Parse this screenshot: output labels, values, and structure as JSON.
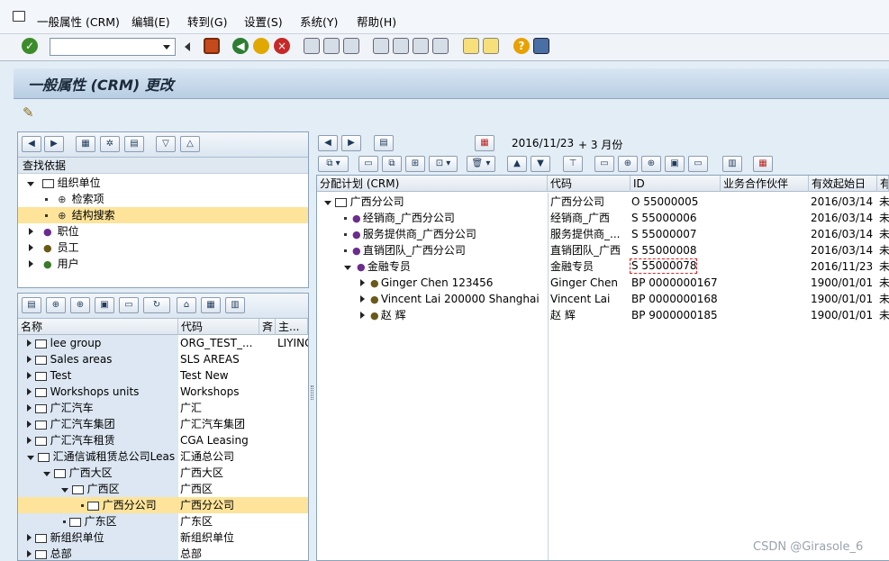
{
  "menu": [
    "一般属性 (CRM)",
    "编辑(E)",
    "转到(G)",
    "设置(S)",
    "系统(Y)",
    "帮助(H)"
  ],
  "title": "一般属性 (CRM) 更改",
  "search": {
    "header": "查找依据",
    "tree": [
      {
        "label": "组织单位"
      },
      {
        "label": "检索项"
      },
      {
        "label": "结构搜索"
      },
      {
        "label": "职位"
      },
      {
        "label": "员工"
      },
      {
        "label": "用户"
      }
    ]
  },
  "hitlist": {
    "col_name": "名称",
    "col_code": "代码",
    "col_x": "斉",
    "col_main": "主...",
    "rows": [
      {
        "name": "lee group",
        "code": "ORG_TEST_...",
        "main": "LIYING"
      },
      {
        "name": "Sales areas",
        "code": "SLS AREAS",
        "main": ""
      },
      {
        "name": "Test",
        "code": "Test New",
        "main": ""
      },
      {
        "name": "Workshops units",
        "code": "Workshops",
        "main": ""
      },
      {
        "name": "广汇汽车",
        "code": "广汇",
        "main": ""
      },
      {
        "name": "广汇汽车集团",
        "code": "广汇汽车集团",
        "main": ""
      },
      {
        "name": "广汇汽车租赁",
        "code": "CGA Leasing",
        "main": ""
      },
      {
        "name": "汇通信诚租赁总公司Leas",
        "code": "汇通总公司",
        "main": ""
      },
      {
        "name": "广西大区",
        "code": "广西大区",
        "main": ""
      },
      {
        "name": "广西区",
        "code": "广西区",
        "main": ""
      },
      {
        "name": "广西分公司",
        "code": "广西分公司",
        "main": ""
      },
      {
        "name": "广东区",
        "code": "广东区",
        "main": ""
      },
      {
        "name": "新组织单位",
        "code": "新组织单位",
        "main": ""
      },
      {
        "name": "总部",
        "code": "总部",
        "main": ""
      }
    ]
  },
  "right": {
    "date": "2016/11/23",
    "range": "+ 3 月份",
    "columns": [
      "分配计划 (CRM)",
      "代码",
      "ID",
      "业务合作伙伴",
      "有效起始日",
      "有"
    ],
    "rows": [
      {
        "name": "广西分公司",
        "code": "广西分公司",
        "id": "O  55000005",
        "date": "2016/03/14",
        "tail": "未"
      },
      {
        "name": "经销商_广西分公司",
        "code": "经销商_广西",
        "id": "S  55000006",
        "date": "2016/03/14",
        "tail": "未"
      },
      {
        "name": "服务提供商_广西分公司",
        "code": "服务提供商_...",
        "id": "S  55000007",
        "date": "2016/03/14",
        "tail": "未"
      },
      {
        "name": "直销团队_广西分公司",
        "code": "直销团队_广西",
        "id": "S  55000008",
        "date": "2016/03/14",
        "tail": "未"
      },
      {
        "name": "金融专员",
        "code": "金融专员",
        "id": "S  55000078",
        "date": "2016/11/23",
        "tail": "未"
      },
      {
        "name": "Ginger Chen 123456",
        "code": "Ginger Chen",
        "id": "BP 0000000167",
        "date": "1900/01/01",
        "tail": "未"
      },
      {
        "name": "Vincent Lai 200000 Shanghai",
        "code": "Vincent Lai",
        "id": "BP 0000000168",
        "date": "1900/01/01",
        "tail": "未"
      },
      {
        "name": "赵 辉",
        "code": "赵 辉",
        "id": "BP 9000000185",
        "date": "1900/01/01",
        "tail": "未"
      }
    ]
  },
  "watermark": "CSDN @Girasole_6"
}
